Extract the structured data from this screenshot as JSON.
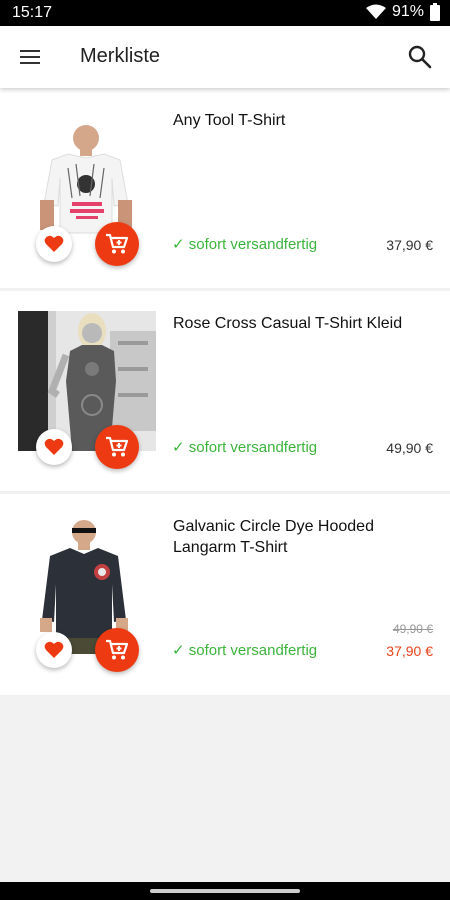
{
  "status": {
    "time": "15:17",
    "battery": "91%"
  },
  "appbar": {
    "title": "Merkliste"
  },
  "items": [
    {
      "name": "Any Tool T-Shirt",
      "availability": "✓ sofort versandfertig",
      "price": "37,90 €",
      "old_price": null
    },
    {
      "name": "Rose Cross Casual T-Shirt Kleid",
      "availability": "✓ sofort versandfertig",
      "price": "49,90 €",
      "old_price": null
    },
    {
      "name": "Galvanic Circle Dye Hooded Langarm T-Shirt",
      "availability": "✓ sofort versandfertig",
      "price": "37,90 €",
      "old_price": "49,90 €"
    }
  ],
  "colors": {
    "accent": "#ee3a12",
    "availability": "#3cb43c",
    "sale_price": "#e8431c"
  },
  "icons": {
    "menu": "menu-icon",
    "search": "search-icon",
    "favorite": "heart-icon",
    "cart": "add-to-cart-icon"
  }
}
